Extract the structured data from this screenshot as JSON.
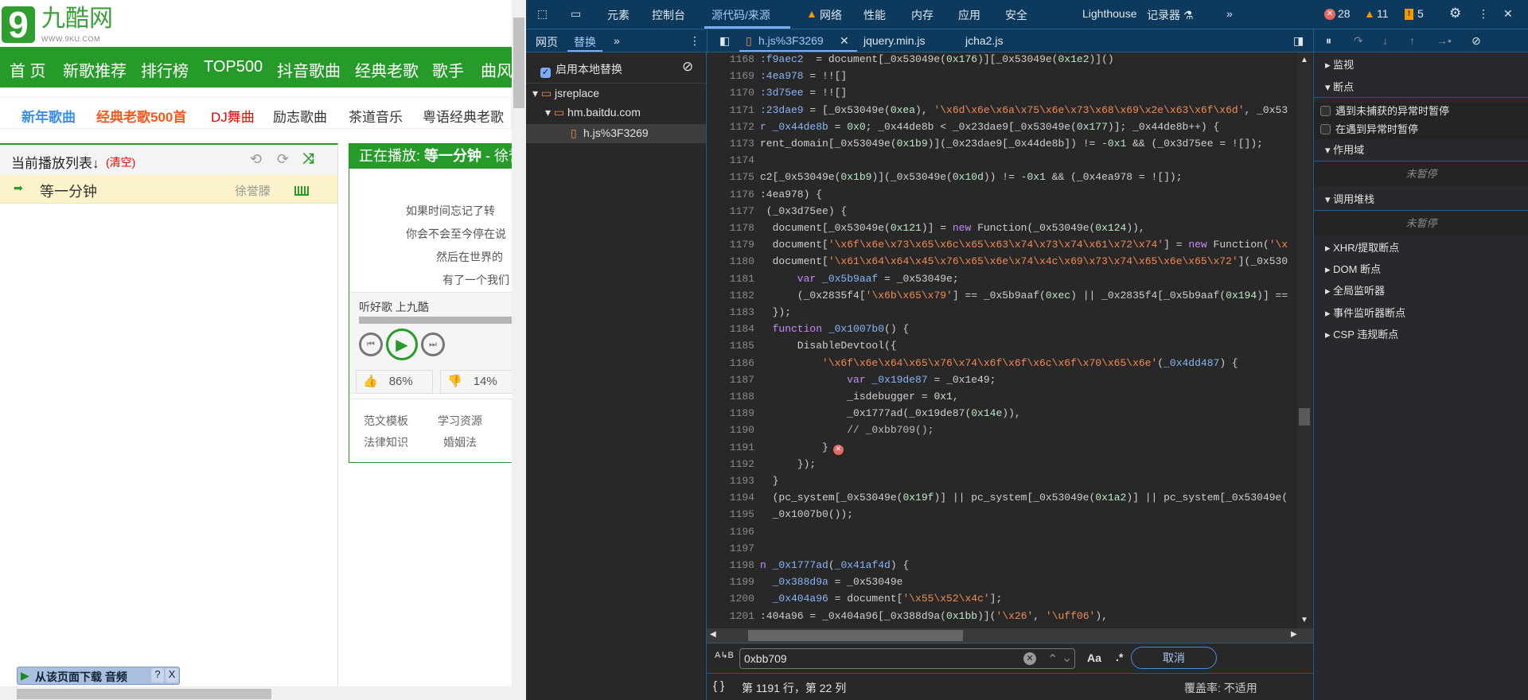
{
  "page": {
    "logo": {
      "text": "九酷网",
      "url": "WWW.9KU.COM",
      "mark": "9"
    },
    "nav": [
      "首 页",
      "新歌推荐",
      "排行榜",
      "TOP500",
      "抖音歌曲",
      "经典老歌",
      "歌手",
      "曲风"
    ],
    "subnav": [
      {
        "label": "新年歌曲",
        "color": "#3b8fe8"
      },
      {
        "label": "经典老歌500首",
        "color": "#f55a1f"
      },
      {
        "label": "DJ舞曲",
        "color": "#e60000"
      },
      {
        "label": "励志歌曲",
        "color": "#333333"
      },
      {
        "label": "茶道音乐",
        "color": "#333333"
      },
      {
        "label": "粤语经典老歌",
        "color": "#333333"
      }
    ],
    "playlist": {
      "title": "当前播放列表↓",
      "clear": "(清空)",
      "items": [
        {
          "song": "等一分钟",
          "artist": "徐誉滕"
        }
      ]
    },
    "now_playing": {
      "label": "正在播放: ",
      "song": "等一分钟",
      "artist": " - 徐誉滕",
      "lyrics": [
        "如果时间忘记了转",
        "你会不会至今停在说",
        "然后在世界的",
        "有了一个我们"
      ],
      "slogan": "听好歌 上九酷",
      "like": "86%",
      "dislike": "14%",
      "links": [
        "范文模板",
        "学习资源",
        "法律知识",
        "婚姻法"
      ]
    },
    "download_bar": {
      "label": "从该页面下载 音频",
      "help": "?",
      "close": "X"
    }
  },
  "devtools": {
    "tabs": [
      "元素",
      "控制台",
      "源代码/来源",
      "网络",
      "性能",
      "内存",
      "应用",
      "安全",
      "Lighthouse",
      "记录器 ⚗",
      "»"
    ],
    "active_tab": "源代码/来源",
    "counts": {
      "errors": "28",
      "warnings": "11",
      "info": "5"
    },
    "nav_tabs": [
      "网页",
      "替换",
      "»"
    ],
    "override_label": "启用本地替换",
    "tree": [
      "jsreplace",
      "hm.baitdu.com",
      "h.js%3F3269"
    ],
    "file_tabs": [
      "h.js%3F3269",
      "jquery.min.js",
      "jcha2.js"
    ],
    "code": [
      {
        "n": "1168",
        "t": [
          [
            "v",
            ":f9aec2"
          ],
          [
            "",
            "  = document[_0x53049e("
          ],
          [
            "n",
            "0x176"
          ],
          [
            "",
            ")][_0x53049e("
          ],
          [
            "n",
            "0x1e2"
          ],
          [
            "",
            ")]()"
          ]
        ]
      },
      {
        "n": "1169",
        "t": [
          [
            "v",
            ":4ea978"
          ],
          [
            "",
            " = !![]"
          ]
        ]
      },
      {
        "n": "1170",
        "t": [
          [
            "v",
            ":3d75ee"
          ],
          [
            "",
            " = !![]"
          ]
        ]
      },
      {
        "n": "1171",
        "t": [
          [
            "v",
            ":23dae9"
          ],
          [
            "",
            " = [_0x53049e("
          ],
          [
            "n",
            "0xea"
          ],
          [
            "",
            "), "
          ],
          [
            "s",
            "'\\x6d\\x6e\\x6a\\x75\\x6e\\x73\\x68\\x69\\x2e\\x63\\x6f\\x6d'"
          ],
          [
            "",
            ", _0x53"
          ]
        ]
      },
      {
        "n": "1172",
        "t": [
          [
            "k",
            "r"
          ],
          [
            "v",
            " _0x44de8b"
          ],
          [
            "",
            " = "
          ],
          [
            "n",
            "0x0"
          ],
          [
            "",
            "; _0x44de8b < _0x23dae9[_0x53049e("
          ],
          [
            "n",
            "0x177"
          ],
          [
            "",
            ")]; _0x44de8b++) {"
          ]
        ]
      },
      {
        "n": "1173",
        "t": [
          [
            "",
            "rent_domain[_0x53049e("
          ],
          [
            "n",
            "0x1b9"
          ],
          [
            "",
            ")](_0x23dae9[_0x44de8b]) != -"
          ],
          [
            "n",
            "0x1"
          ],
          [
            "",
            " && (_0x3d75ee = ![]);"
          ]
        ]
      },
      {
        "n": "1174",
        "t": []
      },
      {
        "n": "1175",
        "t": [
          [
            "",
            "c2[_0x53049e("
          ],
          [
            "n",
            "0x1b9"
          ],
          [
            "",
            ")](_0x53049e("
          ],
          [
            "n",
            "0x10d"
          ],
          [
            "",
            ")) != -"
          ],
          [
            "n",
            "0x1"
          ],
          [
            "",
            " && (_0x4ea978 = ![]);"
          ]
        ]
      },
      {
        "n": "1176",
        "t": [
          [
            "",
            ":4ea978) {"
          ]
        ]
      },
      {
        "n": "1177",
        "t": [
          [
            "",
            " (_0x3d75ee) {"
          ]
        ]
      },
      {
        "n": "1178",
        "t": [
          [
            "",
            "  document[_0x53049e("
          ],
          [
            "n",
            "0x121"
          ],
          [
            "",
            ")] = "
          ],
          [
            "k",
            "new"
          ],
          [
            "",
            " Function(_0x53049e("
          ],
          [
            "n",
            "0x124"
          ],
          [
            "",
            ")),"
          ]
        ]
      },
      {
        "n": "1179",
        "t": [
          [
            "",
            "  document["
          ],
          [
            "s",
            "'\\x6f\\x6e\\x73\\x65\\x6c\\x65\\x63\\x74\\x73\\x74\\x61\\x72\\x74'"
          ],
          [
            "",
            "] = "
          ],
          [
            "k",
            "new"
          ],
          [
            "",
            " Function("
          ],
          [
            "s",
            "'\\x"
          ]
        ]
      },
      {
        "n": "1180",
        "t": [
          [
            "",
            "  document["
          ],
          [
            "s",
            "'\\x61\\x64\\x64\\x45\\x76\\x65\\x6e\\x74\\x4c\\x69\\x73\\x74\\x65\\x6e\\x65\\x72'"
          ],
          [
            "",
            "](_0x530"
          ]
        ]
      },
      {
        "n": "1181",
        "t": [
          [
            "k",
            "      var"
          ],
          [
            "v",
            " _0x5b9aaf"
          ],
          [
            "",
            " = _0x53049e;"
          ]
        ]
      },
      {
        "n": "1182",
        "t": [
          [
            "",
            "      (_0x2835f4["
          ],
          [
            "s",
            "'\\x6b\\x65\\x79'"
          ],
          [
            "",
            "] == _0x5b9aaf("
          ],
          [
            "n",
            "0xec"
          ],
          [
            "",
            ") || _0x2835f4[_0x5b9aaf("
          ],
          [
            "n",
            "0x194"
          ],
          [
            "",
            ")] =="
          ]
        ]
      },
      {
        "n": "1183",
        "t": [
          [
            "",
            "  });"
          ]
        ]
      },
      {
        "n": "1184",
        "t": [
          [
            "k",
            "  function"
          ],
          [
            "v",
            " _0x1007b0"
          ],
          [
            "",
            "() {"
          ]
        ]
      },
      {
        "n": "1185",
        "t": [
          [
            "",
            "      DisableDevtool({"
          ]
        ]
      },
      {
        "n": "1186",
        "t": [
          [
            "s",
            "          '\\x6f\\x6e\\x64\\x65\\x76\\x74\\x6f\\x6f\\x6c\\x6f\\x70\\x65\\x6e'"
          ],
          [
            "",
            "("
          ],
          [
            "v",
            "_0x4dd487"
          ],
          [
            "",
            ") {"
          ]
        ]
      },
      {
        "n": "1187",
        "t": [
          [
            "k",
            "              var"
          ],
          [
            "v",
            " _0x19de87"
          ],
          [
            "",
            " = _0x1e49;"
          ]
        ]
      },
      {
        "n": "1188",
        "t": [
          [
            "",
            "              _isdebugger = "
          ],
          [
            "n",
            "0x1"
          ],
          [
            "",
            ","
          ]
        ]
      },
      {
        "n": "1189",
        "t": [
          [
            "",
            "              _0x1777ad(_0x19de87("
          ],
          [
            "n",
            "0x14e"
          ],
          [
            "",
            ")),"
          ]
        ]
      },
      {
        "n": "1190",
        "t": [
          [
            "c",
            "              // _0xbb709();"
          ]
        ]
      },
      {
        "n": "1191",
        "t": [
          [
            "",
            "          }"
          ]
        ],
        "error": true
      },
      {
        "n": "1192",
        "t": [
          [
            "",
            "      });"
          ]
        ]
      },
      {
        "n": "1193",
        "t": [
          [
            "",
            "  }"
          ]
        ]
      },
      {
        "n": "1194",
        "t": [
          [
            "",
            "  (pc_system[_0x53049e("
          ],
          [
            "n",
            "0x19f"
          ],
          [
            "",
            ")] || pc_system[_0x53049e("
          ],
          [
            "n",
            "0x1a2"
          ],
          [
            "",
            ")] || pc_system[_0x53049e("
          ]
        ]
      },
      {
        "n": "1195",
        "t": [
          [
            "",
            "  _0x1007b0());"
          ]
        ]
      },
      {
        "n": "1196",
        "t": []
      },
      {
        "n": "1197",
        "t": []
      },
      {
        "n": "1198",
        "t": [
          [
            "k",
            "n"
          ],
          [
            "v",
            " _0x1777ad"
          ],
          [
            "",
            "("
          ],
          [
            "v",
            "_0x41af4d"
          ],
          [
            "",
            ") {"
          ]
        ]
      },
      {
        "n": "1199",
        "t": [
          [
            "v",
            "  _0x388d9a"
          ],
          [
            "",
            " = _0x53049e"
          ]
        ]
      },
      {
        "n": "1200",
        "t": [
          [
            "v",
            "  _0x404a96"
          ],
          [
            "",
            " = document["
          ],
          [
            "s",
            "'\\x55\\x52\\x4c'"
          ],
          [
            "",
            "];"
          ]
        ]
      },
      {
        "n": "1201",
        "t": [
          [
            "",
            ":404a96 = _0x404a96[_0x388d9a("
          ],
          [
            "n",
            "0x1bb"
          ],
          [
            "",
            ")]("
          ],
          [
            "s",
            "'\\x26'"
          ],
          [
            "",
            ", "
          ],
          [
            "s",
            "'\\uff06'"
          ],
          [
            "",
            "),"
          ]
        ]
      }
    ],
    "right_panel": {
      "sections": [
        "监视",
        "断点",
        "作用域",
        "调用堆栈",
        "XHR/提取断点",
        "DOM 断点",
        "全局监听器",
        "事件监听器断点",
        "CSP 违规断点"
      ],
      "checkboxes": [
        "遇到未捕获的异常时暂停",
        "在遇到异常时暂停"
      ],
      "not_paused": "未暂停"
    },
    "search": {
      "value": "0xbb709",
      "case": "Aa",
      "regex": ".*",
      "cancel": "取消"
    },
    "status": {
      "position": "第 1191 行，第 22 列",
      "coverage": "覆盖率: 不适用"
    },
    "colors": {
      "toolbar": "#0d3a5c",
      "accent": "#7cacf8",
      "error": "#e46962",
      "warning": "#f29900"
    }
  }
}
